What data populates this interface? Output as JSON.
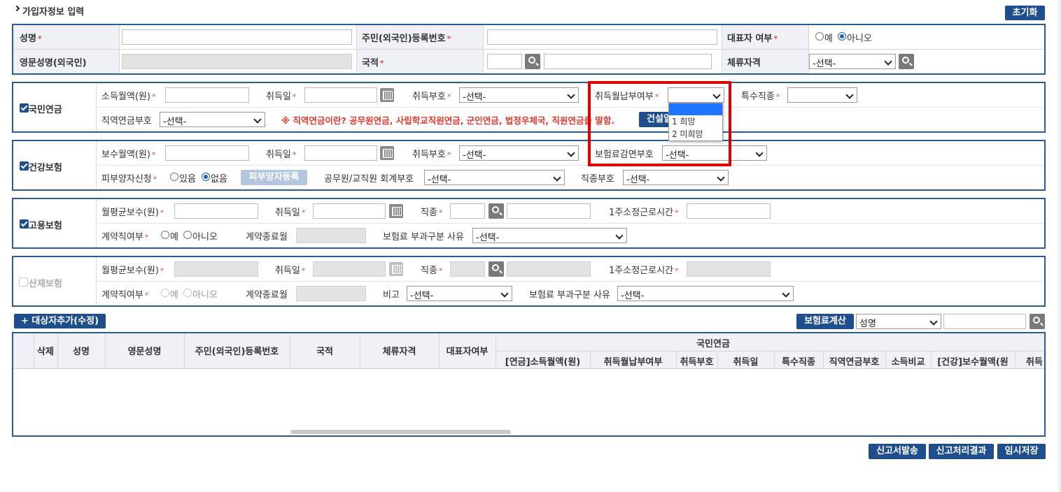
{
  "page": {
    "title": "가입자정보 입력",
    "reset_button": "초기화"
  },
  "basic": {
    "name_label": "성명",
    "rrn_label": "주민(외국인)등록번호",
    "rep_label": "대표자 여부",
    "rep_yes": "예",
    "rep_no": "아니오",
    "eng_name_label": "영문성명(외국인)",
    "nation_label": "국적",
    "stay_label": "체류자격",
    "stay_select": "-선택-"
  },
  "pension": {
    "title": "국민연금",
    "income_label": "소득월액(원)",
    "acq_date_label": "취득일",
    "acq_code_label": "취득부호",
    "acq_code_select": "-선택-",
    "pay_label": "취득월납부여부",
    "special_label": "특수직종",
    "occ_label": "직역연금부호",
    "occ_select": "-선택-",
    "notice": "※ 직역연금이란? 공무원연금, 사립학교직원연금, 군인연금, 법정우체국, 직원연금을 말함.",
    "construction_button": "건설일"
  },
  "dropdown": {
    "options": [
      "",
      "1 희망",
      "2 미희망"
    ]
  },
  "health": {
    "title": "건강보험",
    "wage_label": "보수월액(원)",
    "acq_date_label": "취득일",
    "acq_code_label": "취득부호",
    "acq_code_select": "-선택-",
    "reduction_label": "보험료감면부호",
    "reduction_select": "-선택-",
    "dependent_label": "피부양자신청",
    "dep_yes": "있음",
    "dep_no": "없음",
    "dep_button": "피부양자등록",
    "account_label": "공무원/교직원 회계부호",
    "account_select": "-선택-",
    "job_label": "직종부호",
    "job_select": "-선택-"
  },
  "employment": {
    "title": "고용보험",
    "wage_label": "월평균보수(원)",
    "acq_date_label": "취득일",
    "job_label": "직종",
    "hours_label": "1주소정근로시간",
    "contract_label": "계약직여부",
    "yes": "예",
    "no": "아니오",
    "end_label": "계약종료월",
    "reason_label": "보험료 부과구분 사유",
    "reason_select": "-선택-"
  },
  "accident": {
    "title": "산재보험",
    "wage_label": "월평균보수(원)",
    "acq_date_label": "취득일",
    "job_label": "직종",
    "hours_label": "1주소정근로시간",
    "contract_label": "계약직여부",
    "yes": "예",
    "no": "아니오",
    "end_label": "계약종료월",
    "note_label": "비고",
    "note_select": "-선택-",
    "reason_label": "보험료 부과구분 사유",
    "reason_select": "-선택-"
  },
  "toolbar": {
    "add_button": "+ 대상자추가(수정)",
    "calc_button": "보험료계산",
    "search_select": "성명"
  },
  "table": {
    "headers": [
      "삭제",
      "성명",
      "영문성명",
      "주민(외국인)등록번호",
      "국적",
      "체류자격",
      "대표자여부"
    ],
    "group_header": "국민연금",
    "sub_headers": [
      "[연금]소득월액(원)",
      "취득월납부여부",
      "취득부호",
      "취득일",
      "특수직종",
      "직역연금부호",
      "소득비교",
      "[건강]보수월액(원",
      "취득"
    ]
  },
  "footer": {
    "submit": "신고서발송",
    "result": "신고처리결과",
    "save": "임시저장"
  },
  "colors": {
    "accent": "#1f4e8c",
    "border": "#2c5b91",
    "highlight": "#e00000"
  }
}
